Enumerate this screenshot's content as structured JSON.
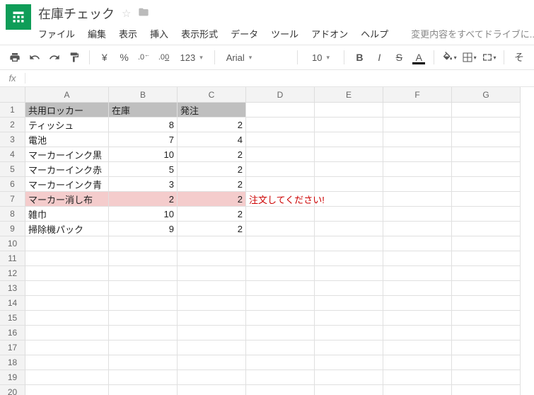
{
  "doc": {
    "title": "在庫チェック"
  },
  "menu": {
    "file": "ファイル",
    "edit": "編集",
    "view": "表示",
    "insert": "挿入",
    "format": "表示形式",
    "data": "データ",
    "tools": "ツール",
    "addons": "アドオン",
    "help": "ヘルプ"
  },
  "status": "変更内容をすべてドライブに...",
  "toolbar": {
    "currency": "¥",
    "percent": "%",
    "dec_dec": ".0",
    "inc_dec": ".00",
    "num_format": "123",
    "font": "Arial",
    "font_size": "10",
    "bold": "B",
    "italic": "I",
    "strike": "S",
    "align_h": "A",
    "more_label": "そ"
  },
  "formula": {
    "label": "fx",
    "value": ""
  },
  "columns": [
    "A",
    "B",
    "C",
    "D",
    "E",
    "F",
    "G"
  ],
  "row_count": 20,
  "sheet": {
    "header_row": [
      "共用ロッカー",
      "在庫",
      "発注"
    ],
    "rows": [
      {
        "a": "ティッシュ",
        "b": "8",
        "c": "2",
        "d": ""
      },
      {
        "a": "電池",
        "b": "7",
        "c": "4",
        "d": ""
      },
      {
        "a": "マーカーインク黒",
        "b": "10",
        "c": "2",
        "d": ""
      },
      {
        "a": "マーカーインク赤",
        "b": "5",
        "c": "2",
        "d": ""
      },
      {
        "a": "マーカーインク青",
        "b": "3",
        "c": "2",
        "d": ""
      },
      {
        "a": "マーカー消し布",
        "b": "2",
        "c": "2",
        "d": "注文してください!",
        "warn": true
      },
      {
        "a": "雑巾",
        "b": "10",
        "c": "2",
        "d": ""
      },
      {
        "a": "掃除機パック",
        "b": "9",
        "c": "2",
        "d": ""
      }
    ]
  }
}
